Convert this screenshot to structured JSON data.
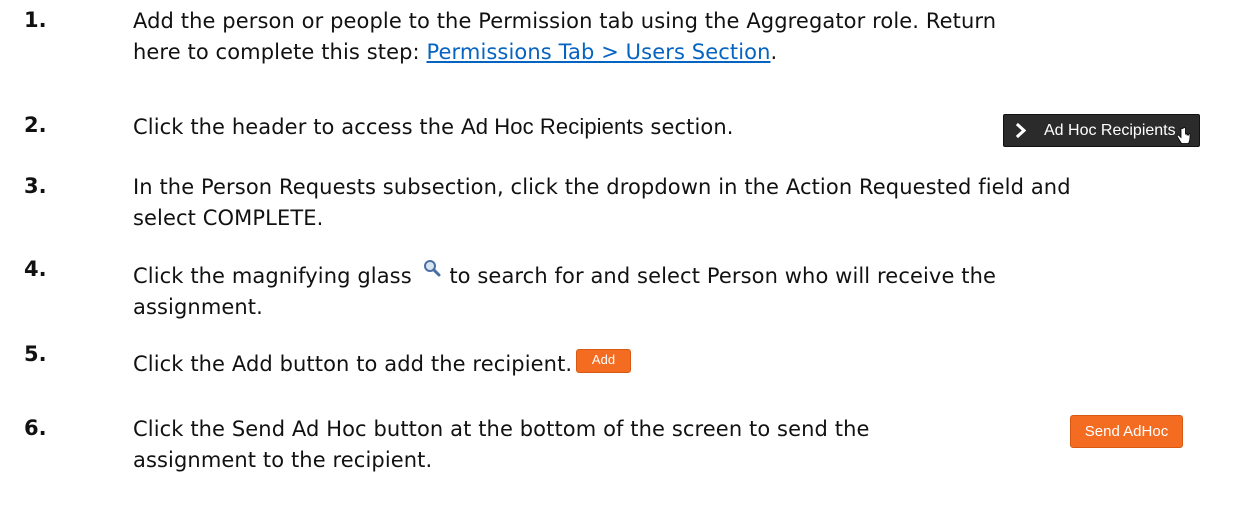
{
  "steps": [
    {
      "number": "1.",
      "line1": "Add the person or people to the Permission tab using the Aggregator role.  Return",
      "line2_prefix": "here to complete this step: ",
      "link_text": "Permissions Tab > Users Section",
      "line2_suffix": "."
    },
    {
      "number": "2.",
      "text_before": "Click the header to access the ",
      "text_sans": "Ad Hoc Recipients",
      "text_after": " section."
    },
    {
      "number": "3.",
      "line1": "In the Person Requests subsection, click the dropdown in the Action Requested field and",
      "line2": "select COMPLETE."
    },
    {
      "number": "4.",
      "line1_before": "Click the magnifying glass ",
      "line1_after": " to search for and select Person who will receive the",
      "line2": "assignment."
    },
    {
      "number": "5.",
      "text": "Click the Add button to add the recipient."
    },
    {
      "number": "6.",
      "line1": "Click the Send Ad Hoc button at the bottom of the screen to send the",
      "line2": "assignment to the recipient."
    }
  ],
  "adhoc_header": {
    "icon": "chevron-right-icon",
    "label": "Ad Hoc Recipients",
    "cursor_icon": "hand-pointer-icon"
  },
  "add_button": {
    "label": "Add"
  },
  "send_adhoc_button": {
    "label": "Send AdHoc"
  },
  "colors": {
    "link": "#0563c1",
    "button_orange": "#f36c21",
    "header_dark": "#2b2b2b",
    "text": "#111111"
  }
}
